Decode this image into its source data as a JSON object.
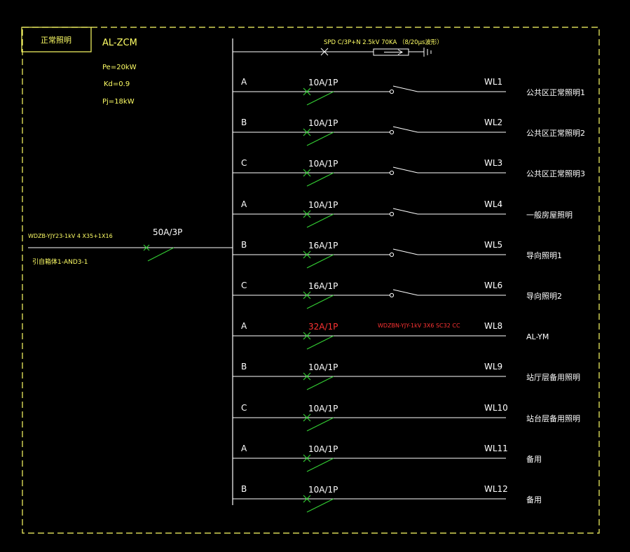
{
  "panel": {
    "title": "正常照明",
    "name": "AL-ZCM",
    "pe": "Pe=20kW",
    "kd": "Kd=0.9",
    "pj": "Pj=18kW"
  },
  "incoming": {
    "cable": "WDZB-YJY23-1kV 4 X35+1X16",
    "source": "引自箱体1-AND3-1",
    "breaker": "50A/3P"
  },
  "spd": {
    "label": "SPD C/3P+N 2.5kV 70KA （8/20μs波形）"
  },
  "circuits": [
    {
      "phase": "A",
      "breaker": "10A/1P",
      "switch": true,
      "cable": "",
      "id": "WL1",
      "load": "公共区正常照明1",
      "highlight": false
    },
    {
      "phase": "B",
      "breaker": "10A/1P",
      "switch": true,
      "cable": "",
      "id": "WL2",
      "load": "公共区正常照明2",
      "highlight": false
    },
    {
      "phase": "C",
      "breaker": "10A/1P",
      "switch": true,
      "cable": "",
      "id": "WL3",
      "load": "公共区正常照明3",
      "highlight": false
    },
    {
      "phase": "A",
      "breaker": "10A/1P",
      "switch": true,
      "cable": "",
      "id": "WL4",
      "load": "一般房屋照明",
      "highlight": false
    },
    {
      "phase": "B",
      "breaker": "16A/1P",
      "switch": true,
      "cable": "",
      "id": "WL5",
      "load": "导向照明1",
      "highlight": false
    },
    {
      "phase": "C",
      "breaker": "16A/1P",
      "switch": true,
      "cable": "",
      "id": "WL6",
      "load": "导向照明2",
      "highlight": false
    },
    {
      "phase": "A",
      "breaker": "32A/1P",
      "switch": false,
      "cable": "WDZBN-YJY-1kV 3X6 SC32 CC",
      "id": "WL8",
      "load": "AL-YM",
      "highlight": true
    },
    {
      "phase": "B",
      "breaker": "10A/1P",
      "switch": false,
      "cable": "",
      "id": "WL9",
      "load": "站厅层备用照明",
      "highlight": false
    },
    {
      "phase": "C",
      "breaker": "10A/1P",
      "switch": false,
      "cable": "",
      "id": "WL10",
      "load": "站台层备用照明",
      "highlight": false
    },
    {
      "phase": "A",
      "breaker": "10A/1P",
      "switch": false,
      "cable": "",
      "id": "WL11",
      "load": "备用",
      "highlight": false
    },
    {
      "phase": "B",
      "breaker": "10A/1P",
      "switch": false,
      "cable": "",
      "id": "WL12",
      "load": "备用",
      "highlight": false
    }
  ],
  "colors": {
    "background": "#000000",
    "line": "#ffffff",
    "text_yellow": "#ffff66",
    "breaker_green": "#33cc33",
    "frame_yellow": "#ffff66",
    "highlight_red": "#ff3333"
  }
}
